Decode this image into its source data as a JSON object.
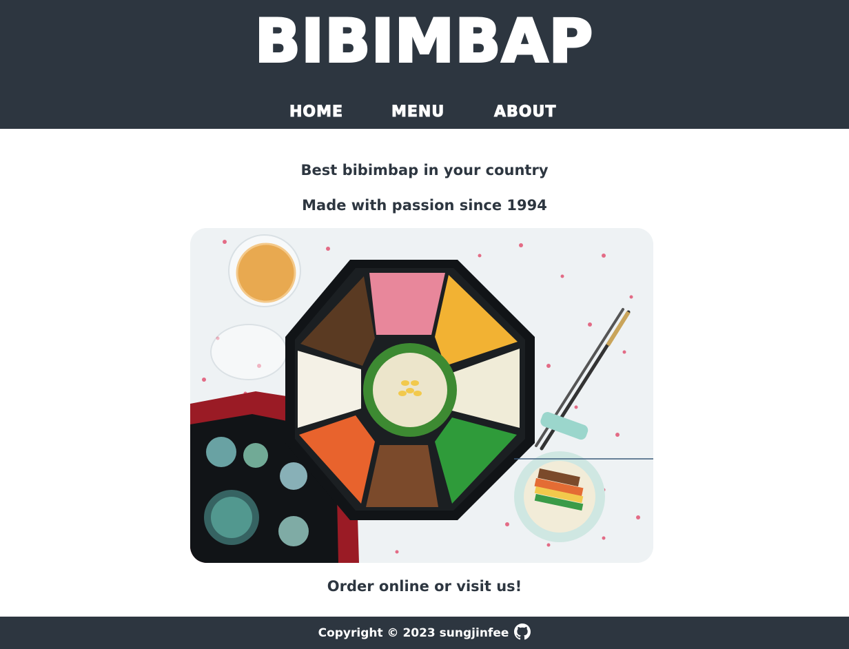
{
  "header": {
    "title": "BIBIMBAP",
    "nav": [
      {
        "label": "HOME"
      },
      {
        "label": "MENU"
      },
      {
        "label": "ABOUT"
      }
    ]
  },
  "main": {
    "tagline": "Best bibimbap in your country",
    "subtitle": "Made with passion since 1994",
    "call_to_action": "Order online or visit us!",
    "hero_image": {
      "subject": "bibimbap platter with chopsticks and wine glass"
    }
  },
  "footer": {
    "copyright": "Copyright © 2023 sungjinfee",
    "icon": "github-icon"
  },
  "colors": {
    "header_bg": "#2d3640",
    "text": "#2d3640",
    "header_text": "#ffffff",
    "page_bg": "#ffffff"
  }
}
